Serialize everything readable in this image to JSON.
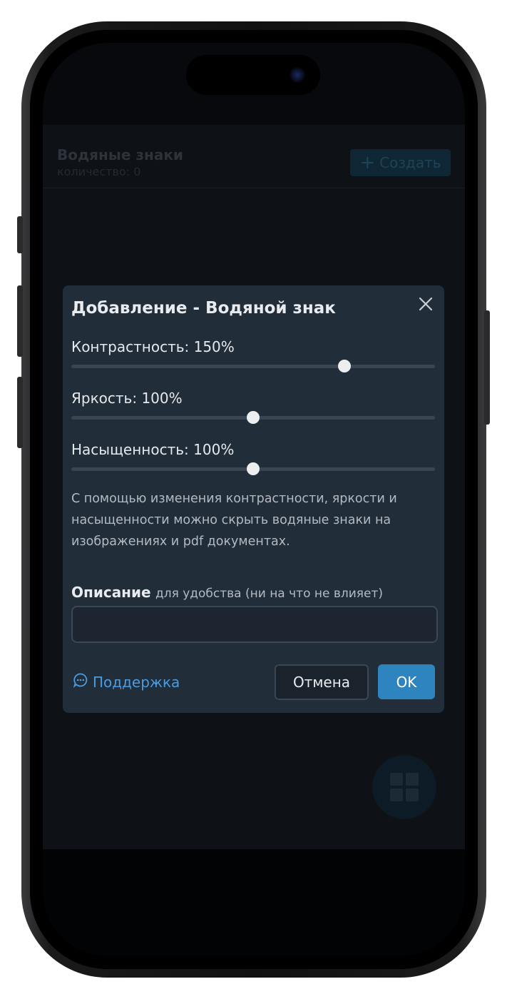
{
  "app": {
    "title": "Водяные знаки",
    "count_label": "количество: 0",
    "create_button": "Создать"
  },
  "modal": {
    "title": "Добавление - Водяной знак",
    "sliders": [
      {
        "label": "Контрастность: 150%",
        "value_percent": 150,
        "fill_fraction": 0.75
      },
      {
        "label": "Яркость: 100%",
        "value_percent": 100,
        "fill_fraction": 0.5
      },
      {
        "label": "Насыщенность: 100%",
        "value_percent": 100,
        "fill_fraction": 0.5
      }
    ],
    "hint": "С помощью изменения контрастности, яркости и насыщенности можно скрыть водяные знаки на изображениях и pdf документах.",
    "description_label": "Описание",
    "description_sub": "для удобства (ни на что не влияет)",
    "description_value": "",
    "support_link": "Поддержка",
    "cancel_button": "Отмена",
    "ok_button": "OK"
  },
  "colors": {
    "modal_bg": "#222d3a",
    "accent": "#2d84bf",
    "link": "#4a9be0"
  },
  "icons": {
    "close": "close-icon",
    "support": "chat-bubble-icon",
    "plus": "plus-icon",
    "fab": "grid-icon"
  }
}
